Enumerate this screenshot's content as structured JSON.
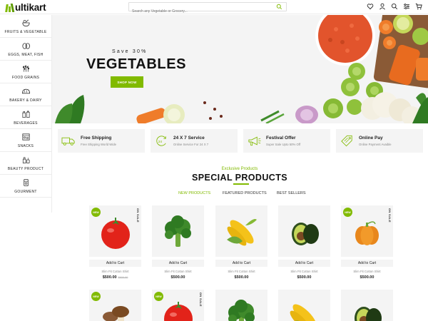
{
  "header": {
    "logo_text": "ultikart",
    "search_placeholder": "Search any Vegetable or Grocery..."
  },
  "icons": [
    "heart-icon",
    "user-icon",
    "search-icon",
    "settings-icon",
    "cart-icon"
  ],
  "sidebar": {
    "items": [
      {
        "label": "FRUITS & VEGETABLE",
        "icon": "fruits-vegetable-icon"
      },
      {
        "label": "EGGS, MEAT, FISH",
        "icon": "eggs-meat-fish-icon"
      },
      {
        "label": "FOOD GRAINS",
        "icon": "food-grains-icon"
      },
      {
        "label": "BAKERY & DAIRY",
        "icon": "bakery-dairy-icon"
      },
      {
        "label": "BEVERAGES",
        "icon": "beverages-icon"
      },
      {
        "label": "SNACKS",
        "icon": "snacks-icon"
      },
      {
        "label": "BEAUTY PRODUCT",
        "icon": "beauty-product-icon"
      },
      {
        "label": "GOURMENT",
        "icon": "gourmet-icon"
      }
    ]
  },
  "banner": {
    "subtitle": "Save 30%",
    "title": "VEGETABLES",
    "button": "SHOP NOW"
  },
  "services": [
    {
      "title": "Free Shipping",
      "desc": "Free Shipping World Wide",
      "icon": "truck-icon"
    },
    {
      "title": "24 X 7 Service",
      "desc": "Online Service For 24 X 7",
      "icon": "clock-24-icon"
    },
    {
      "title": "Festival Offer",
      "desc": "Super Sale Upto 50% Off",
      "icon": "megaphone-icon"
    },
    {
      "title": "Online Pay",
      "desc": "Online Payment Avaible",
      "icon": "payment-tag-icon"
    }
  ],
  "section": {
    "eyebrow": "Exclusive Products",
    "title": "SPECIAL PRODUCTS"
  },
  "tabs": [
    {
      "label": "NEW PRODUCTS",
      "active": true
    },
    {
      "label": "FEATURED PRODUCTS",
      "active": false
    },
    {
      "label": "BEST SELLERS",
      "active": false
    }
  ],
  "products": [
    {
      "image": "tomato",
      "badge": "NEW",
      "tag": "ON SALE",
      "button": "Add to Cart",
      "name": "Slim Fit Cotton Shirt",
      "price": "$500.00",
      "old_price": "$600.00"
    },
    {
      "image": "broccoli",
      "button": "Add to Cart",
      "name": "Slim Fit Cotton Shirt",
      "price": "$500.00"
    },
    {
      "image": "corn",
      "button": "Add to Cart",
      "name": "Slim Fit Cotton Shirt",
      "price": "$500.00"
    },
    {
      "image": "avocado",
      "button": "Add to Cart",
      "name": "Slim Fit Cotton Shirt",
      "price": "$500.00"
    },
    {
      "image": "pumpkin",
      "badge": "NEW",
      "tag": "ON SALE",
      "button": "Add to Cart",
      "name": "Slim Fit Cotton Shirt",
      "price": "$500.00"
    },
    {
      "image": "mushroom",
      "badge": "NEW"
    },
    {
      "image": "tomato",
      "badge": "NEW",
      "tag": "ON SALE"
    },
    {
      "image": "broccoli"
    },
    {
      "image": "corn"
    },
    {
      "image": "avocado"
    }
  ],
  "colors": {
    "accent": "#81ba00",
    "panel": "#f4f4f4"
  }
}
